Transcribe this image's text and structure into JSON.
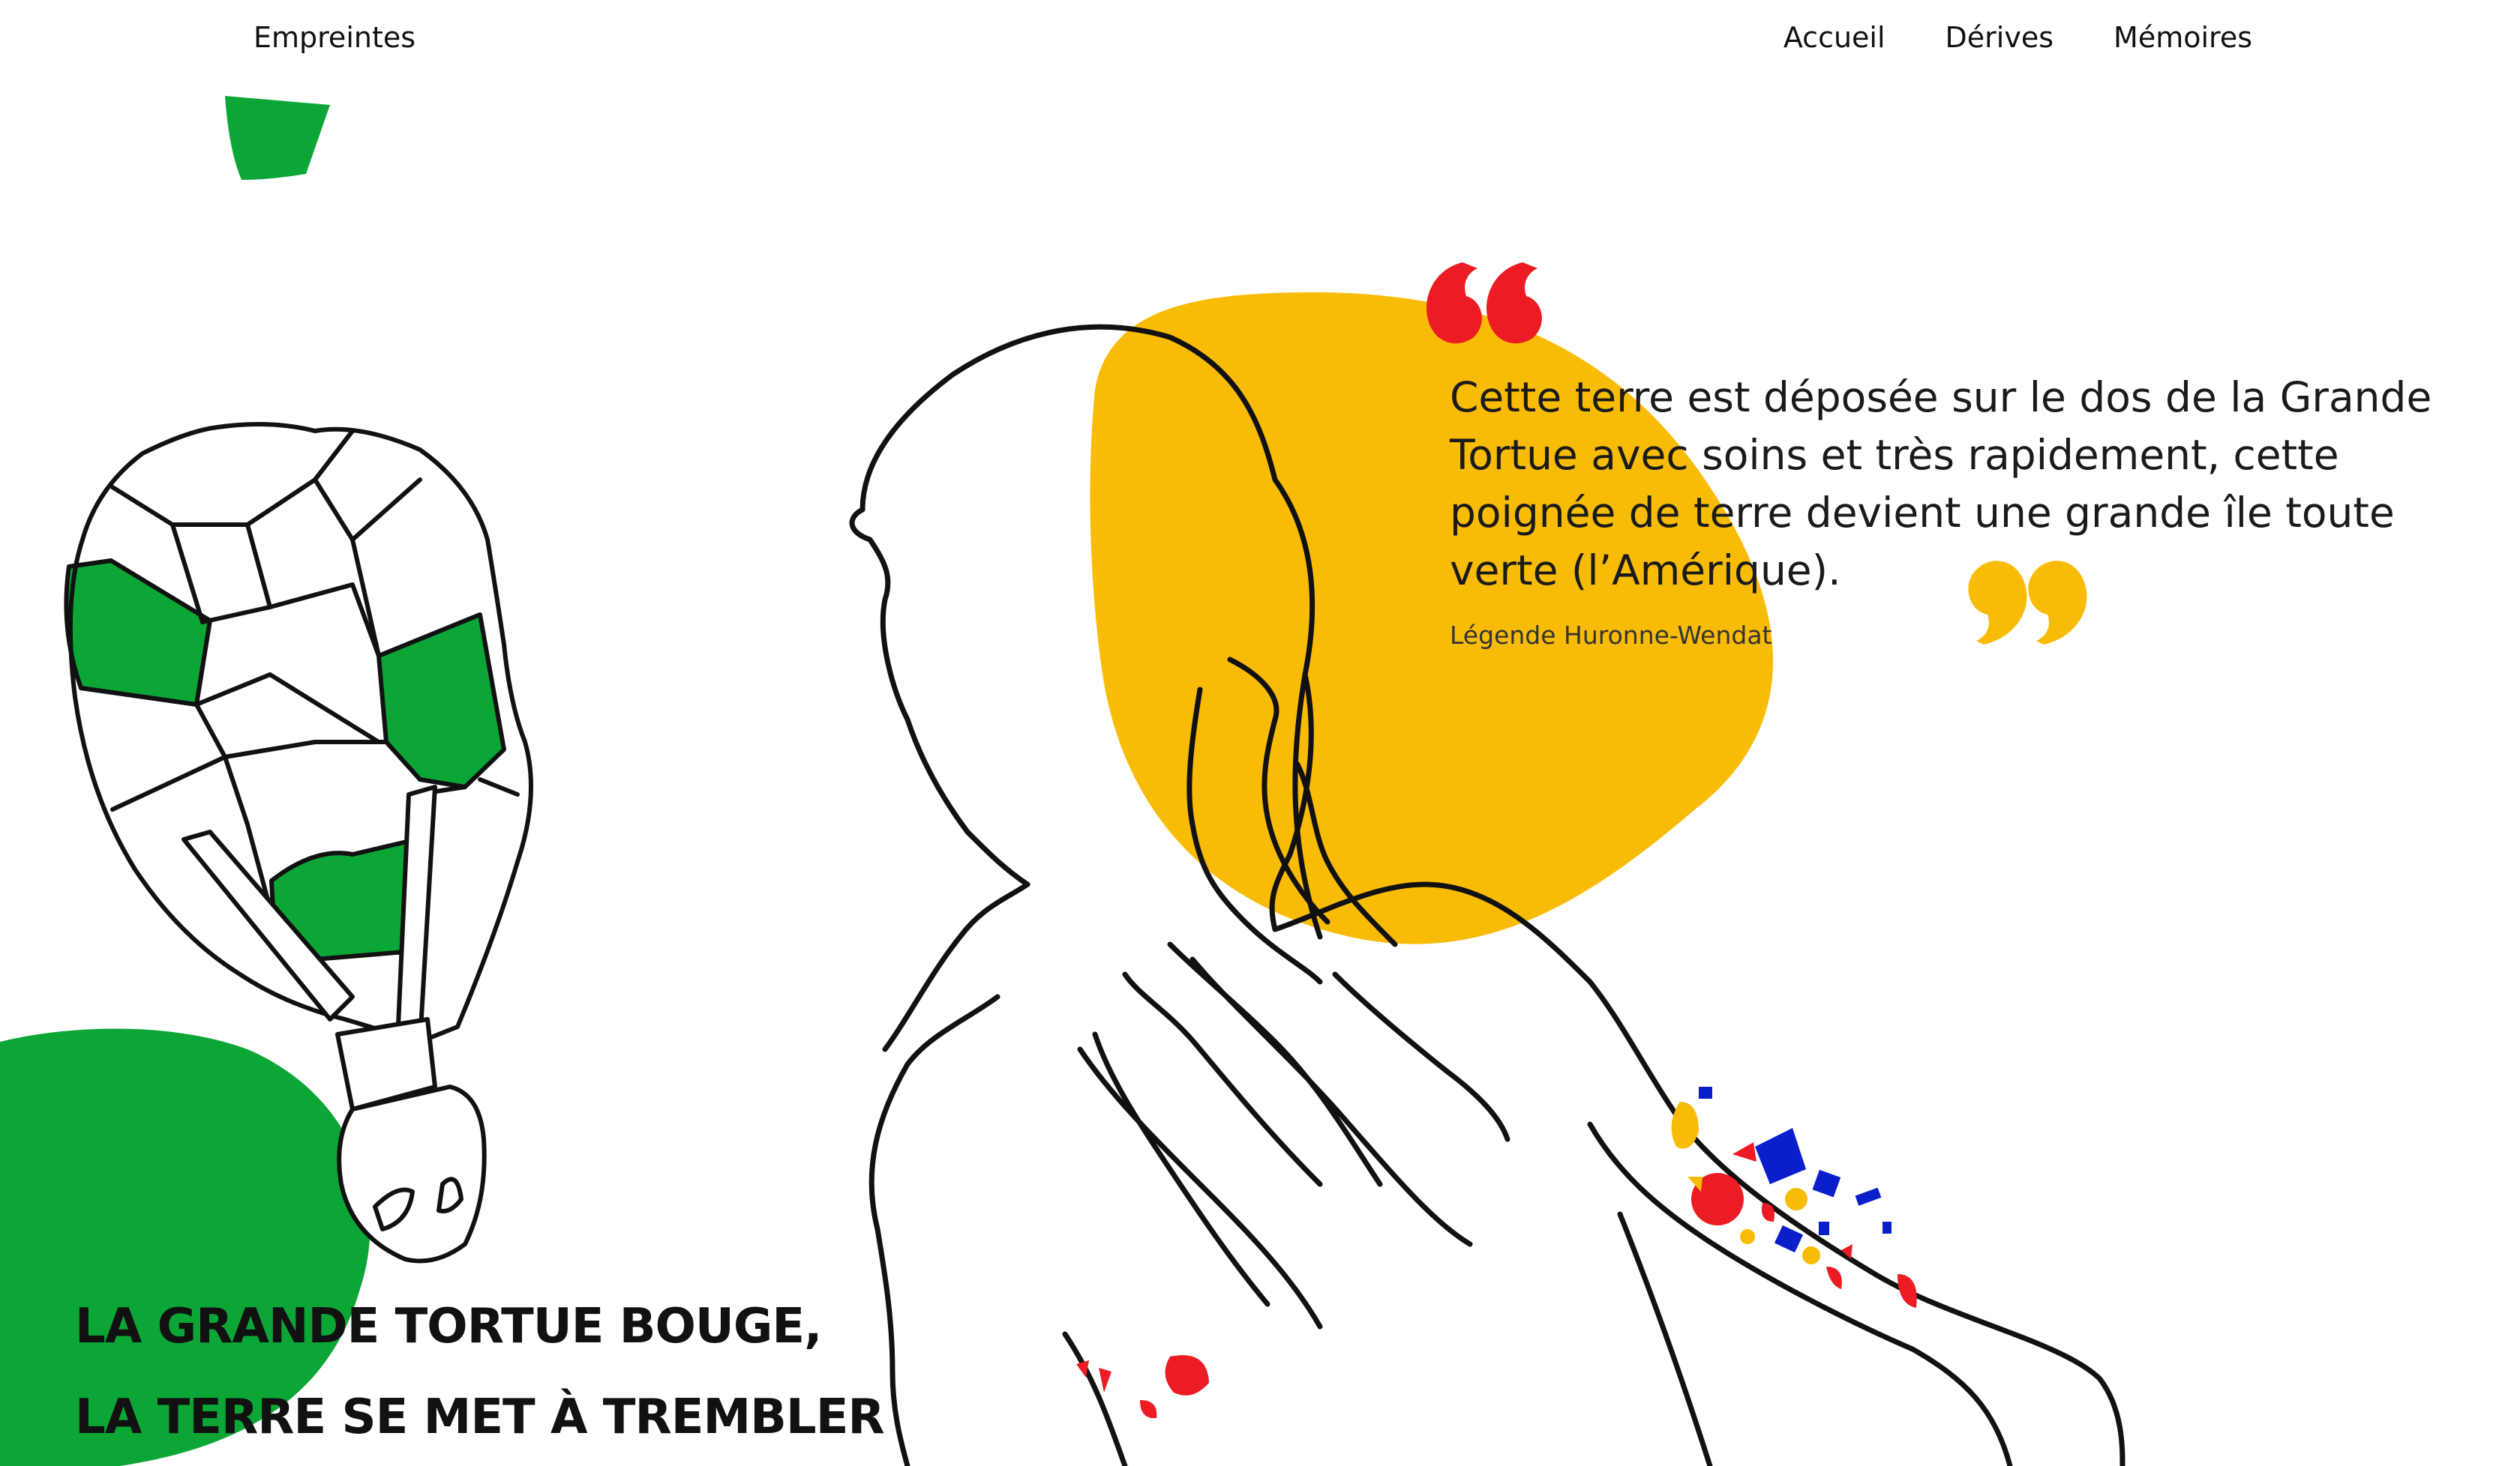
{
  "header": {
    "brand": "Empreintes",
    "nav": [
      {
        "label": "Accueil"
      },
      {
        "label": "Dérives"
      },
      {
        "label": "Mémoires"
      }
    ]
  },
  "quote": {
    "text": "Cette terre est déposée sur le dos de la Grande Tortue avec soins et très rapidement, cette poignée de terre devient une grande île toute verte (l’Amérique).",
    "attribution": "Légende Huronne-Wendat",
    "mark_color": "#ED1C24"
  },
  "headline": {
    "line1": "LA GRANDE TORTUE BOUGE,",
    "line2": "LA TERRE SE MET À TREMBLER"
  },
  "colors": {
    "green": "#0CA637",
    "yellow": "#F9BC06",
    "red": "#ED1C24",
    "blue": "#0A1FC9",
    "ink": "#111111"
  },
  "illustrations": {
    "turtle": "turtle-line-drawing",
    "figure": "human-figure-line-drawing"
  }
}
